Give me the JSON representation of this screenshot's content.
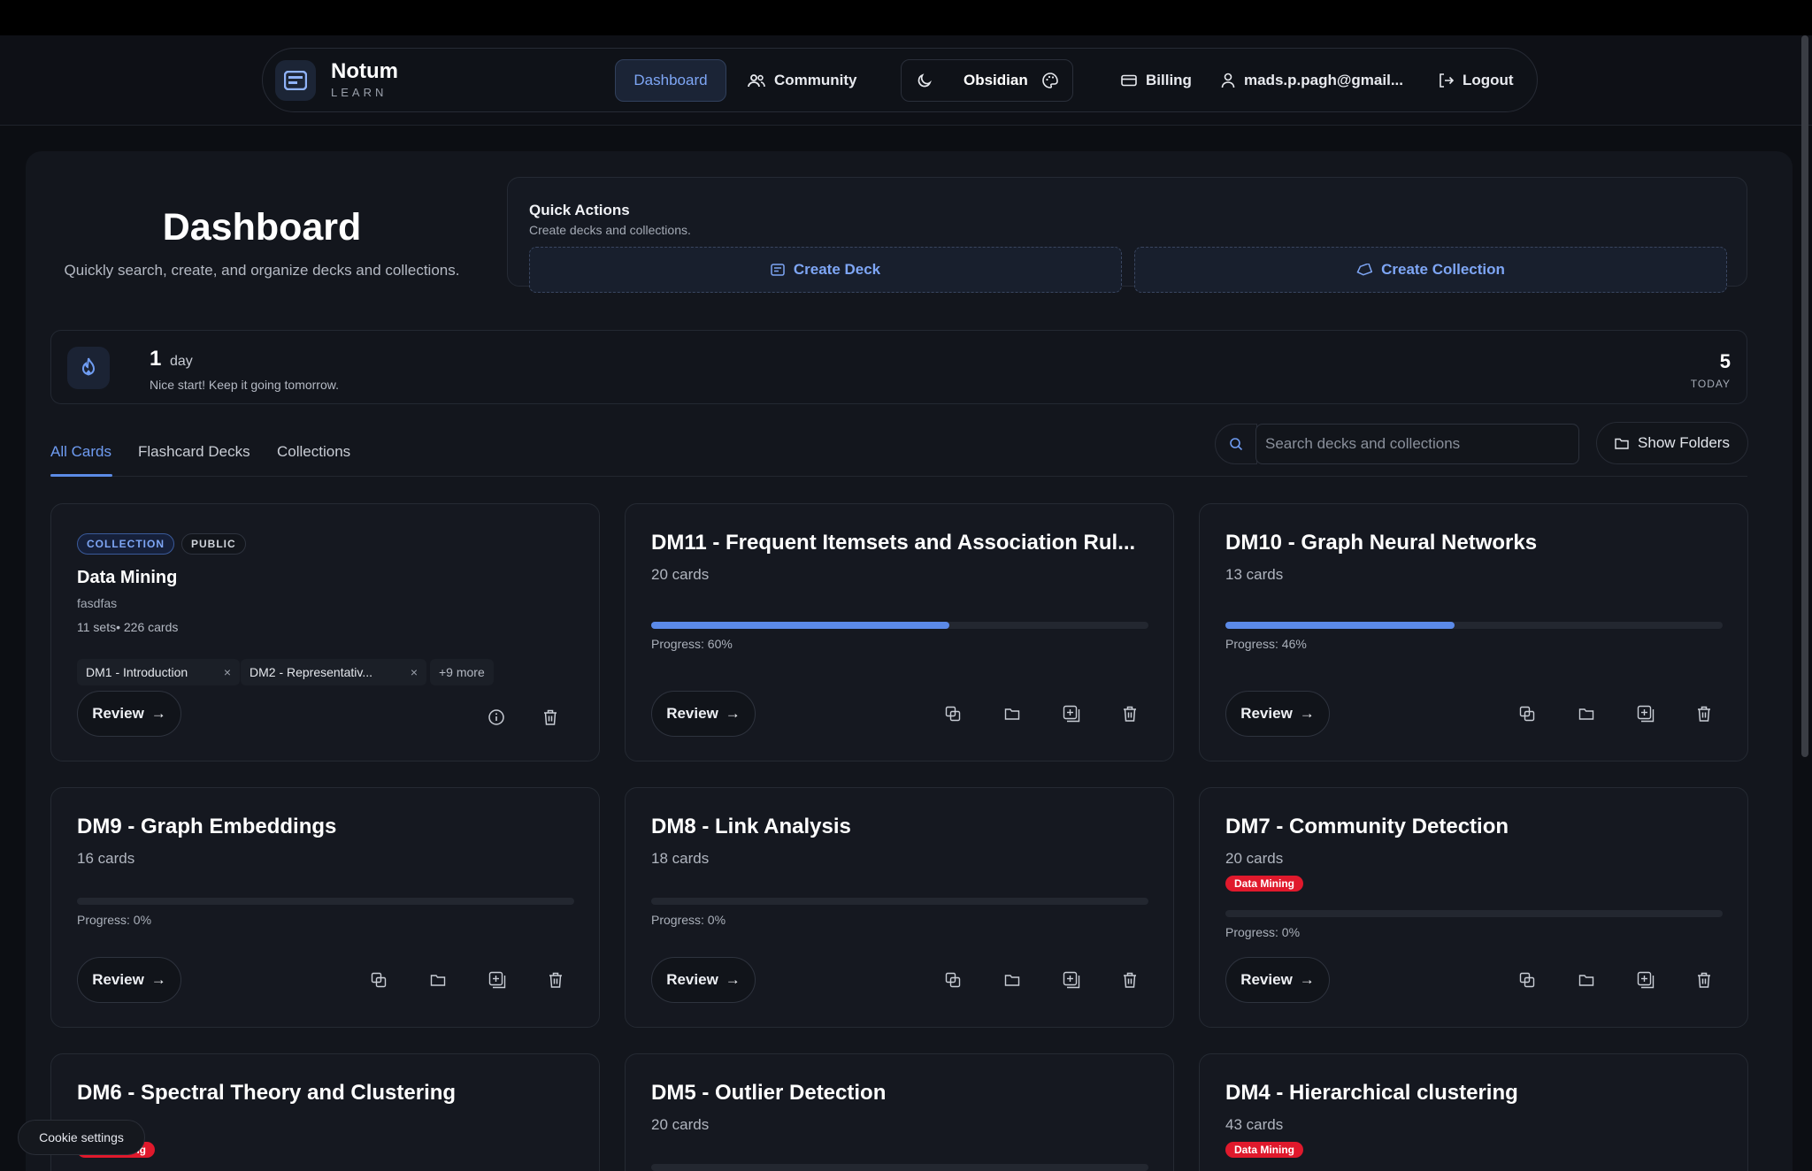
{
  "nav": {
    "brand_name": "Notum",
    "brand_sub": "LEARN",
    "dashboard": "Dashboard",
    "community": "Community",
    "theme_name": "Obsidian",
    "billing": "Billing",
    "user_email": "mads.p.pagh@gmail...",
    "logout": "Logout"
  },
  "header": {
    "title": "Dashboard",
    "subtitle": "Quickly search, create, and organize decks and collections."
  },
  "quick_actions": {
    "title": "Quick Actions",
    "subtitle": "Create decks and collections.",
    "create_deck": "Create Deck",
    "create_collection": "Create Collection"
  },
  "streak": {
    "count": "1",
    "unit": "day",
    "message": "Nice start! Keep it going tomorrow.",
    "today_count": "5",
    "today_label": "TODAY"
  },
  "tabs": [
    "All Cards",
    "Flashcard Decks",
    "Collections"
  ],
  "search": {
    "placeholder": "Search decks and collections"
  },
  "show_folders": "Show Folders",
  "review_label": "Review",
  "collection_card": {
    "badge_collection": "COLLECTION",
    "badge_public": "PUBLIC",
    "title": "Data Mining",
    "description": "fasdfas",
    "meta": "11 sets• 226 cards",
    "chips": [
      "DM1 - Introduction",
      "DM2 - Representativ..."
    ],
    "more": "+9 more"
  },
  "decks": [
    {
      "title": "DM11 - Frequent Itemsets and Association Rul...",
      "count": "20 cards",
      "progress": 60,
      "progress_label": "Progress: 60%",
      "tag": ""
    },
    {
      "title": "DM10 - Graph Neural Networks",
      "count": "13 cards",
      "progress": 46,
      "progress_label": "Progress: 46%",
      "tag": ""
    },
    {
      "title": "DM9 - Graph Embeddings",
      "count": "16 cards",
      "progress": 0,
      "progress_label": "Progress: 0%",
      "tag": ""
    },
    {
      "title": "DM8 - Link Analysis",
      "count": "18 cards",
      "progress": 0,
      "progress_label": "Progress: 0%",
      "tag": ""
    },
    {
      "title": "DM7 - Community Detection",
      "count": "20 cards",
      "progress": 0,
      "progress_label": "Progress: 0%",
      "tag": "Data Mining"
    },
    {
      "title": "DM6 - Spectral Theory and Clustering",
      "count": "",
      "progress": 0,
      "progress_label": "",
      "tag": "Data Mining"
    },
    {
      "title": "DM5 - Outlier Detection",
      "count": "20 cards",
      "progress": 0,
      "progress_label": "",
      "tag": ""
    },
    {
      "title": "DM4 - Hierarchical clustering",
      "count": "43 cards",
      "progress": 0,
      "progress_label": "",
      "tag": "Data Mining"
    }
  ],
  "cookie_settings": "Cookie settings",
  "colors": {
    "accent": "#5b8ae8",
    "tag_red": "#e0192c",
    "background": "#0c0e13"
  }
}
